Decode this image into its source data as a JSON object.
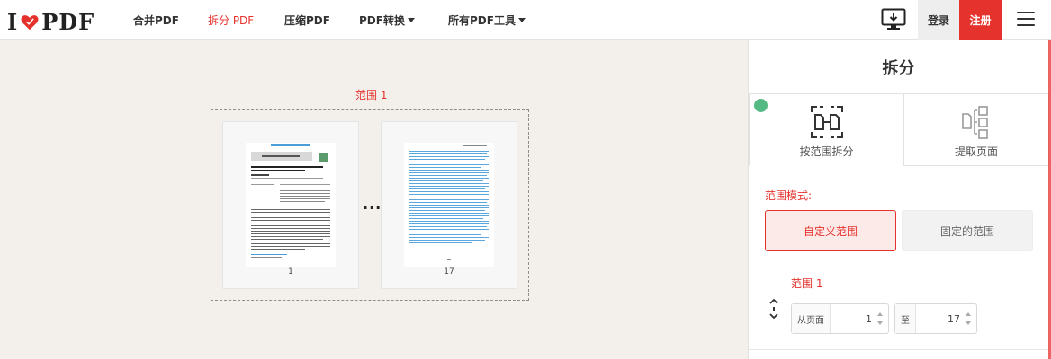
{
  "header": {
    "logo": {
      "prefix": "I",
      "suffix": "PDF"
    },
    "nav": [
      {
        "label": "合并PDF",
        "active": false,
        "dropdown": false
      },
      {
        "label": "拆分 PDF",
        "active": true,
        "dropdown": false
      },
      {
        "label": "压缩PDF",
        "active": false,
        "dropdown": false
      },
      {
        "label": "PDF转换",
        "active": false,
        "dropdown": true
      },
      {
        "label": "所有PDF工具",
        "active": false,
        "dropdown": true
      }
    ],
    "login_label": "登录",
    "register_label": "注册",
    "icons": [
      "desktop-download-icon",
      "hamburger-menu-icon"
    ]
  },
  "workspace": {
    "range_title": "范围 1",
    "pages": [
      {
        "label": "1"
      },
      {
        "label": "17"
      }
    ],
    "separator": "..."
  },
  "panel": {
    "title": "拆分",
    "modes": [
      {
        "label": "按范围拆分",
        "selected": true
      },
      {
        "label": "提取页面",
        "selected": false
      }
    ],
    "range_mode_label": "范围模式:",
    "range_mode_options": [
      {
        "label": "自定义范围",
        "selected": true
      },
      {
        "label": "固定的范围",
        "selected": false
      }
    ],
    "range": {
      "title": "范围 1",
      "from_label": "从页面",
      "from_value": "1",
      "to_label": "至",
      "to_value": "17"
    }
  },
  "colors": {
    "brand_red": "#e5322d",
    "workspace_bg": "#f3f0ec",
    "check_green": "#55b984"
  }
}
